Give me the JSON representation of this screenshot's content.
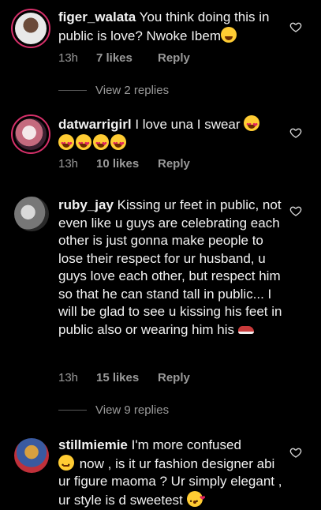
{
  "comments": [
    {
      "username": "figer_walata",
      "text": " You think doing this in public is love? Nwoke Ibem",
      "time": "13h",
      "likes": "7 likes",
      "reply": "Reply",
      "view_replies": "View 2 replies"
    },
    {
      "username": "datwarrigirl",
      "text": " I love una I swear",
      "time": "13h",
      "likes": "10 likes",
      "reply": "Reply"
    },
    {
      "username": "ruby_jay",
      "text": " Kissing ur feet in public, not even like u guys are celebrating each other is just gonna make people to lose their respect for ur husband, u guys love each other, but respect him so that he can stand tall in public... I will be glad to see u kissing his feet in public also or wearing him his",
      "time": "13h",
      "likes": "15 likes",
      "reply": "Reply",
      "view_replies": "View 9 replies"
    },
    {
      "username": "stillmiemie",
      "text_part1": " I'm more confused",
      "text_part2": " now , is it ur fashion designer abi ur figure maoma ? Ur simply elegant , ur style is d sweetest"
    }
  ],
  "colors": {
    "background": "#000000",
    "meta": "#9a9a9a",
    "ring": "#d6306a"
  },
  "icons": [
    "heart-outline-icon",
    "avatar"
  ]
}
